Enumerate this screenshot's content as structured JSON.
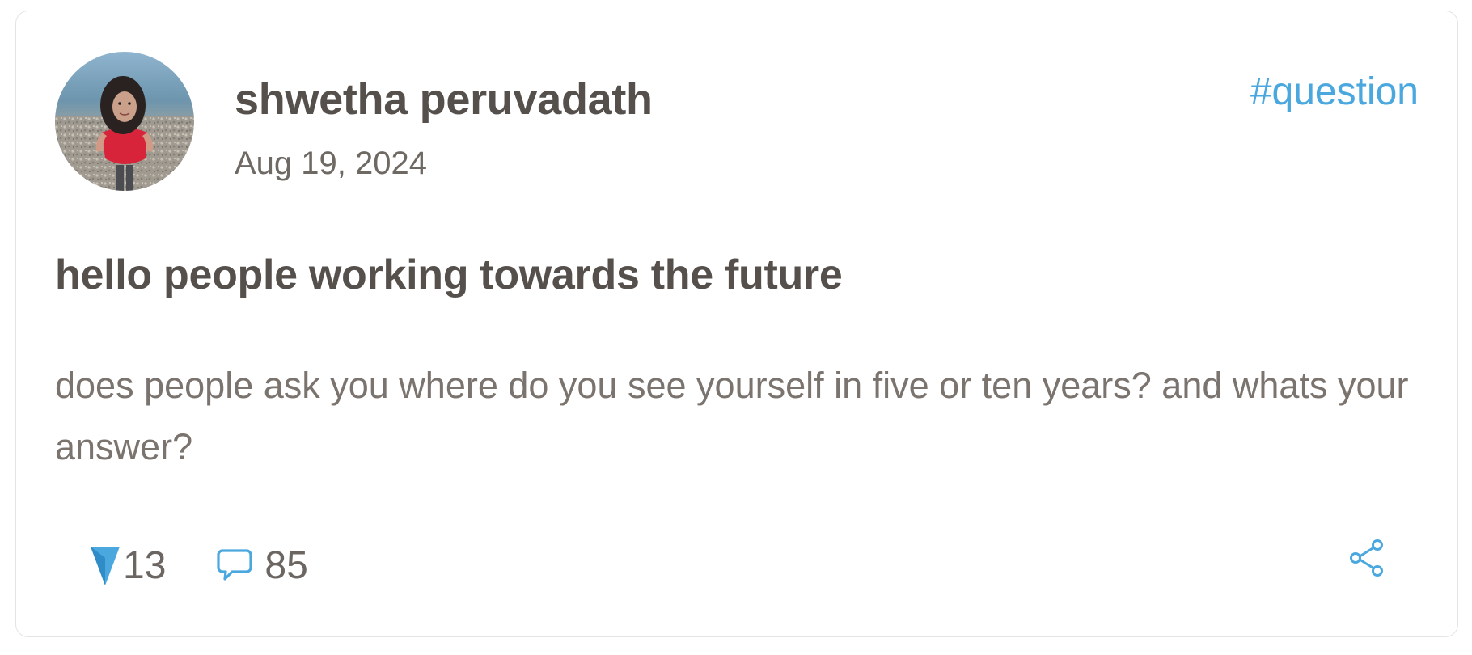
{
  "post": {
    "author": {
      "name": "shwetha peruvadath",
      "avatar_icon": "profile-photo"
    },
    "date": "Aug 19, 2024",
    "tag": "#question",
    "title": "hello people working towards the future",
    "body": "does people ask you where do you see yourself in five or ten years? and whats your answer?",
    "stats": {
      "upvotes": "13",
      "comments": "85"
    }
  },
  "icons": {
    "upvote": "upvote-arrow-icon",
    "comment": "speech-bubble-icon",
    "share": "share-icon"
  },
  "colors": {
    "accent": "#4aa8df",
    "heading": "#55504c",
    "body_text": "#7a736e",
    "border": "#e4e4e4"
  }
}
